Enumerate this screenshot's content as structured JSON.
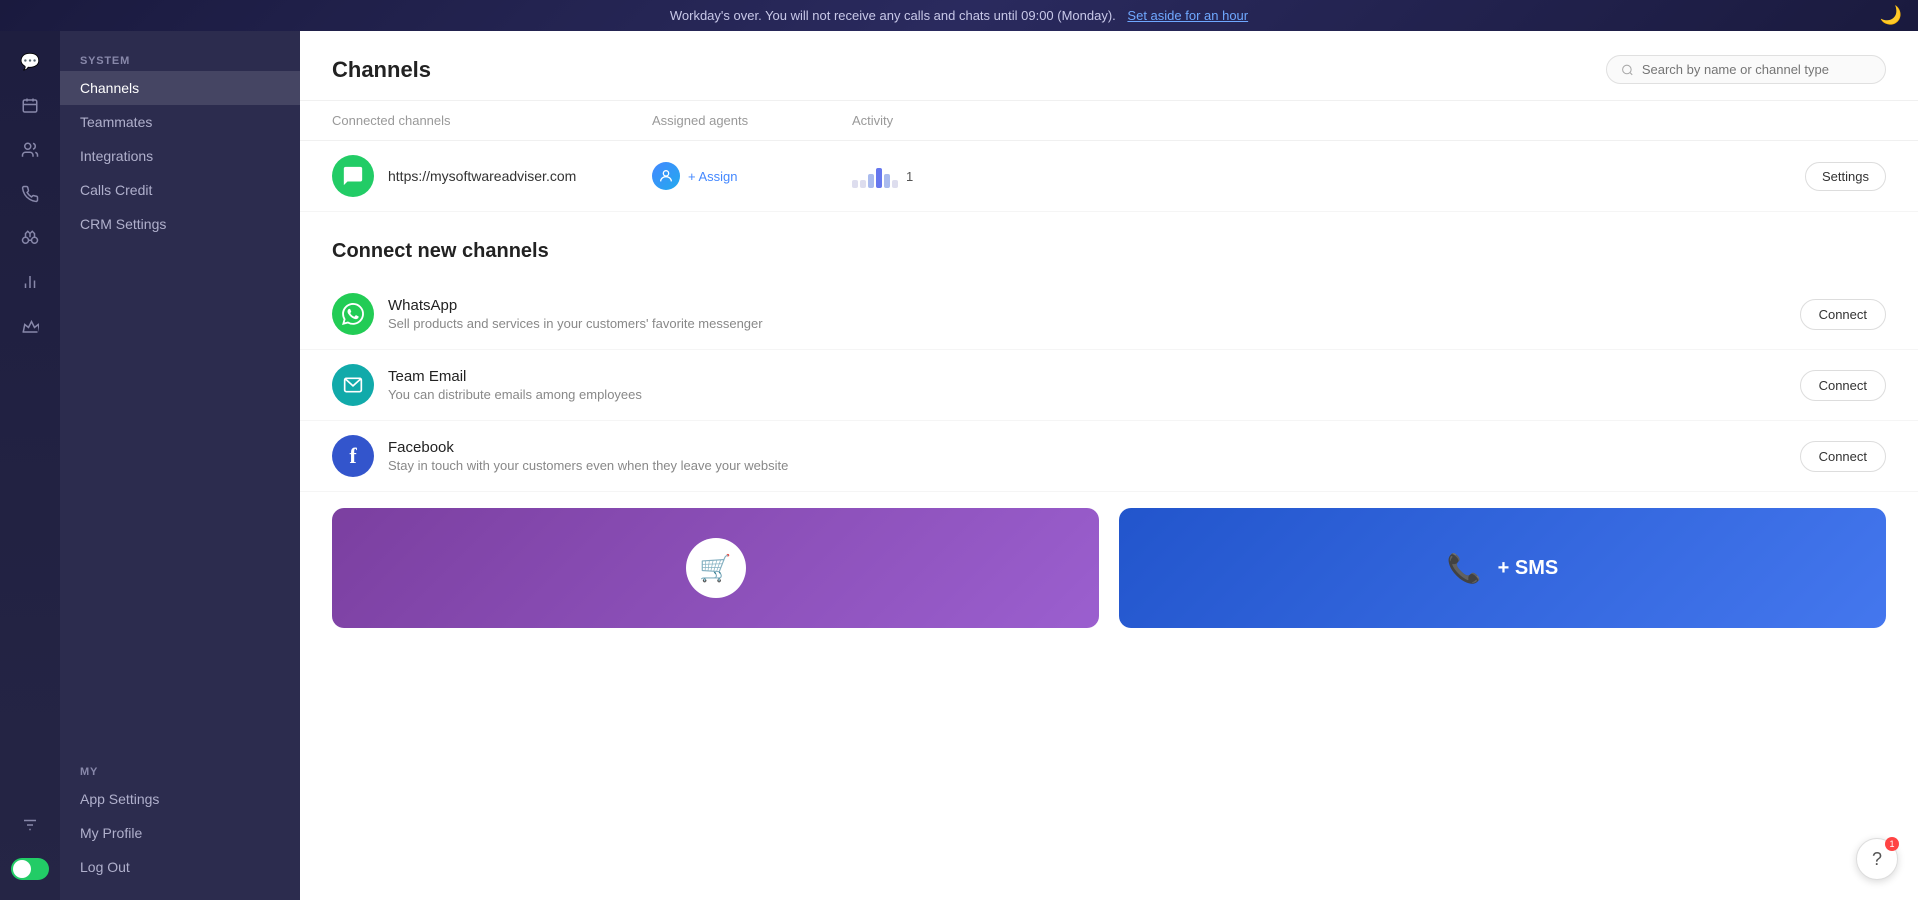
{
  "banner": {
    "message": "Workday's over. You will not receive any calls and chats until 09:00 (Monday).",
    "link_text": "Set aside for an hour",
    "moon": "🌙"
  },
  "icon_sidebar": {
    "icons": [
      {
        "name": "chat-icon",
        "symbol": "💬",
        "active": false
      },
      {
        "name": "contacts-icon",
        "symbol": "👤",
        "active": false
      },
      {
        "name": "team-icon",
        "symbol": "👥",
        "active": false
      },
      {
        "name": "phone-icon",
        "symbol": "📞",
        "active": false
      },
      {
        "name": "binoculars-icon",
        "symbol": "🔭",
        "active": false
      },
      {
        "name": "chart-icon",
        "symbol": "📊",
        "active": false
      },
      {
        "name": "crown-icon",
        "symbol": "👑",
        "active": false
      },
      {
        "name": "settings-icon",
        "symbol": "⚙",
        "active": false
      }
    ]
  },
  "nav_sidebar": {
    "system_label": "SYSTEM",
    "my_label": "MY",
    "system_items": [
      {
        "label": "Channels",
        "active": true
      },
      {
        "label": "Teammates",
        "active": false
      },
      {
        "label": "Integrations",
        "active": false
      },
      {
        "label": "Calls Credit",
        "active": false
      },
      {
        "label": "CRM Settings",
        "active": false
      }
    ],
    "my_items": [
      {
        "label": "App Settings",
        "active": false
      },
      {
        "label": "My Profile",
        "active": false
      },
      {
        "label": "Log Out",
        "active": false
      }
    ]
  },
  "main": {
    "title": "Channels",
    "search_placeholder": "Search by name or channel type",
    "table": {
      "headers": {
        "connected": "Connected channels",
        "agents": "Assigned agents",
        "activity": "Activity"
      },
      "rows": [
        {
          "url": "https://mysoftwareadviser.com",
          "icon_color": "green",
          "icon_symbol": "💬",
          "agent_count": 1,
          "activity_count": "1",
          "assign_label": "+ Assign"
        }
      ]
    },
    "connect_section_title": "Connect new channels",
    "connect_channels": [
      {
        "name": "WhatsApp",
        "desc": "Sell products and services in your customers' favorite messenger",
        "icon": "whatsapp",
        "icon_bg": "#22cc55",
        "icon_symbol": "💬",
        "btn_label": "Connect"
      },
      {
        "name": "Team Email",
        "desc": "You can distribute emails among employees",
        "icon": "email",
        "icon_bg": "#11aaaa",
        "icon_symbol": "✉",
        "btn_label": "Connect"
      },
      {
        "name": "Facebook",
        "desc": "Stay in touch with your customers even when they leave your website",
        "icon": "facebook",
        "icon_bg": "#3355cc",
        "icon_symbol": "f",
        "btn_label": "Connect"
      }
    ],
    "promo_cards": [
      {
        "type": "purple",
        "icon": "🛒",
        "text": ""
      },
      {
        "type": "blue",
        "icon": "📞",
        "text": "+ SMS"
      }
    ]
  },
  "help": {
    "symbol": "?",
    "notification_count": "1"
  }
}
